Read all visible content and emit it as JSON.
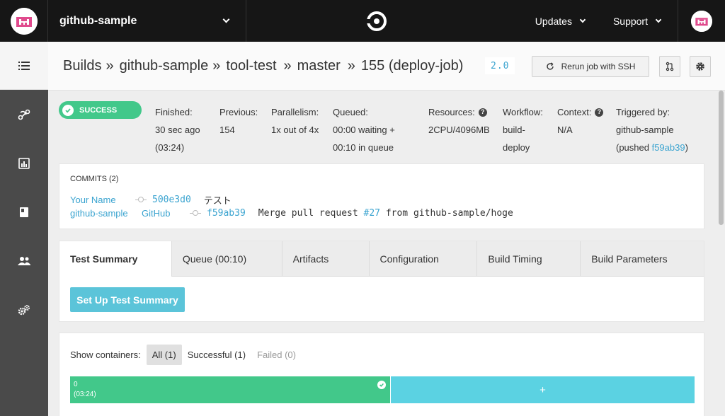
{
  "topbar": {
    "project_name": "github-sample",
    "updates_label": "Updates",
    "support_label": "Support"
  },
  "header": {
    "crumbs": [
      "Builds",
      "github-sample",
      "tool-test",
      "master",
      "155 (deploy-job)"
    ],
    "separator": "»",
    "version": "2.0",
    "rerun_label": "Rerun job with SSH"
  },
  "status": {
    "badge": "SUCCESS"
  },
  "meta": {
    "finished_label": "Finished:",
    "finished_value": "30 sec ago",
    "finished_duration": "(03:24)",
    "previous_label": "Previous:",
    "previous_value": "154",
    "parallelism_label": "Parallelism:",
    "parallelism_value": "1x out of 4x",
    "queued_label": "Queued:",
    "queued_line1": "00:00 waiting +",
    "queued_line2": "00:10 in queue",
    "resources_label": "Resources:",
    "resources_value": "2CPU/4096MB",
    "workflow_label": "Workflow:",
    "workflow_line1": "build-",
    "workflow_line2": "deploy",
    "context_label": "Context:",
    "context_value": "N/A",
    "triggered_label": "Triggered by:",
    "triggered_user": "github-sample",
    "triggered_prefix": "(pushed ",
    "triggered_sha": "f59ab39",
    "triggered_suffix": ")"
  },
  "commits": {
    "title": "COMMITS (2)",
    "rows": [
      {
        "author": "Your Name",
        "committer": "",
        "sha": "500e3d0",
        "message_pre": "テスト",
        "pr": "",
        "message_post": ""
      },
      {
        "author": "github-sample",
        "committer": "GitHub",
        "sha": "f59ab39",
        "message_pre": "Merge pull request ",
        "pr": "#27",
        "message_post": " from github-sample/hoge"
      }
    ]
  },
  "tabs": [
    {
      "label": "Test Summary",
      "active": true
    },
    {
      "label": "Queue (00:10)"
    },
    {
      "label": "Artifacts"
    },
    {
      "label": "Configuration"
    },
    {
      "label": "Build Timing"
    },
    {
      "label": "Build Parameters"
    }
  ],
  "test_summary": {
    "setup_button": "Set Up Test Summary"
  },
  "containers": {
    "label": "Show containers:",
    "filters": [
      "All (1)",
      "Successful (1)",
      "Failed (0)"
    ],
    "container_index": "0",
    "container_duration": "(03:24)",
    "add_symbol": "+"
  },
  "colors": {
    "success": "#42c88a",
    "link": "#3ba4d0",
    "setup_button": "#5bc4d9",
    "topbar": "#161616",
    "sidebar": "#4a4a4a"
  }
}
